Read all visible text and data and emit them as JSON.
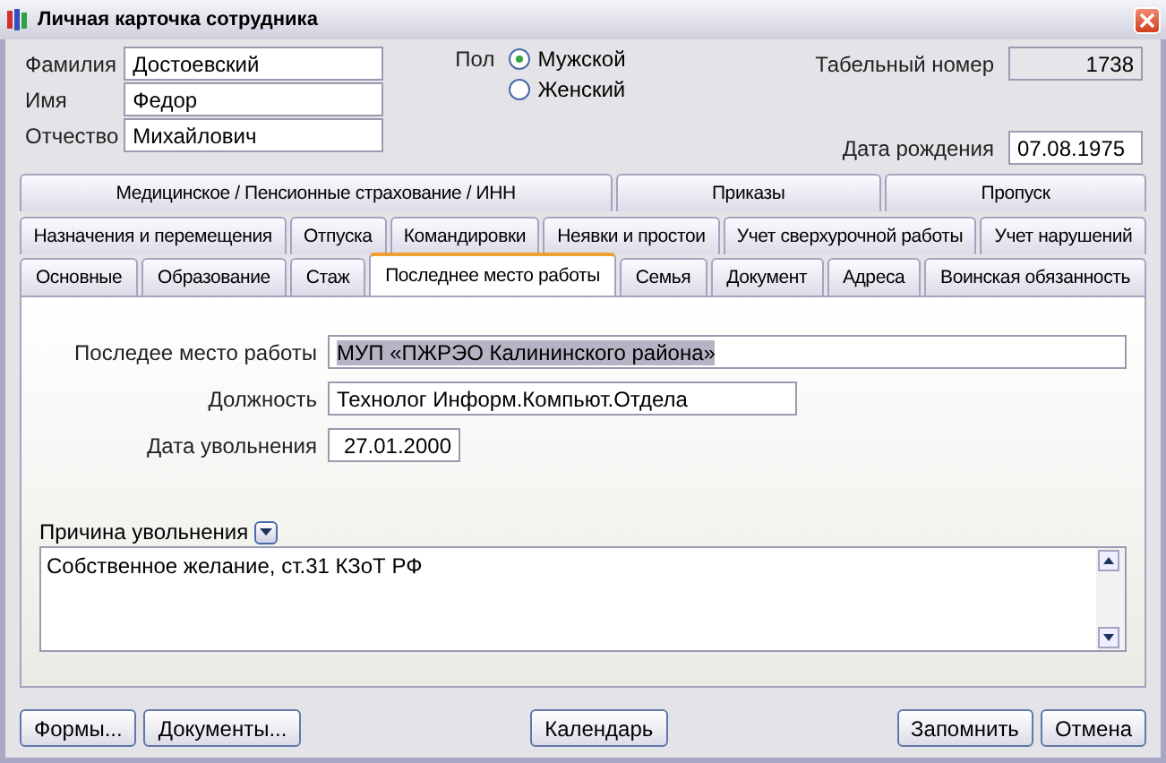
{
  "window": {
    "title": "Личная карточка сотрудника"
  },
  "person": {
    "fields": [
      {
        "label": "Фамилия",
        "value": "Достоевский"
      },
      {
        "label": "Имя",
        "value": "Федор"
      },
      {
        "label": "Отчество",
        "value": "Михайлович"
      }
    ]
  },
  "gender": {
    "label": "Пол",
    "options": [
      {
        "label": "Мужской",
        "selected": true
      },
      {
        "label": "Женский",
        "selected": false
      }
    ]
  },
  "employee_number": {
    "label": "Табельный номер",
    "value": "1738"
  },
  "birth_date": {
    "label": "Дата рождения",
    "value": "07.08.1975"
  },
  "tab_rows": [
    [
      {
        "label": "Медицинское / Пенсионные страхование / ИНН",
        "selected": false
      },
      {
        "label": "Приказы",
        "selected": false
      },
      {
        "label": "Пропуск",
        "selected": false
      }
    ],
    [
      {
        "label": "Назначения и перемещения",
        "selected": false
      },
      {
        "label": "Отпуска",
        "selected": false
      },
      {
        "label": "Командировки",
        "selected": false
      },
      {
        "label": "Неявки и простои",
        "selected": false
      },
      {
        "label": "Учет сверхурочной работы",
        "selected": false
      },
      {
        "label": "Учет нарушений",
        "selected": false
      }
    ],
    [
      {
        "label": "Основные",
        "selected": false
      },
      {
        "label": "Образование",
        "selected": false
      },
      {
        "label": "Стаж",
        "selected": false
      },
      {
        "label": "Последнее место работы",
        "selected": true
      },
      {
        "label": "Семья",
        "selected": false
      },
      {
        "label": "Документ",
        "selected": false
      },
      {
        "label": "Адреса",
        "selected": false
      },
      {
        "label": "Воинская обязанность",
        "selected": false
      }
    ]
  ],
  "panel": {
    "fields": [
      {
        "label": "Последее место работы",
        "value": "МУП «ПЖРЭО Калининского района»",
        "kind": "full",
        "text_selected": true
      },
      {
        "label": "Должность",
        "value": "Технолог Информ.Компьют.Отдела",
        "kind": "medium",
        "text_selected": false
      },
      {
        "label": "Дата увольнения",
        "value": "27.01.2000",
        "kind": "date",
        "text_selected": false
      }
    ],
    "reason": {
      "label": "Причина увольнения",
      "value": "Собственное желание, ст.31 КЗоТ РФ"
    }
  },
  "buttons_left": [
    "Формы...",
    "Документы..."
  ],
  "buttons_center": [
    "Календарь"
  ],
  "buttons_right": [
    "Запомнить",
    "Отмена"
  ]
}
